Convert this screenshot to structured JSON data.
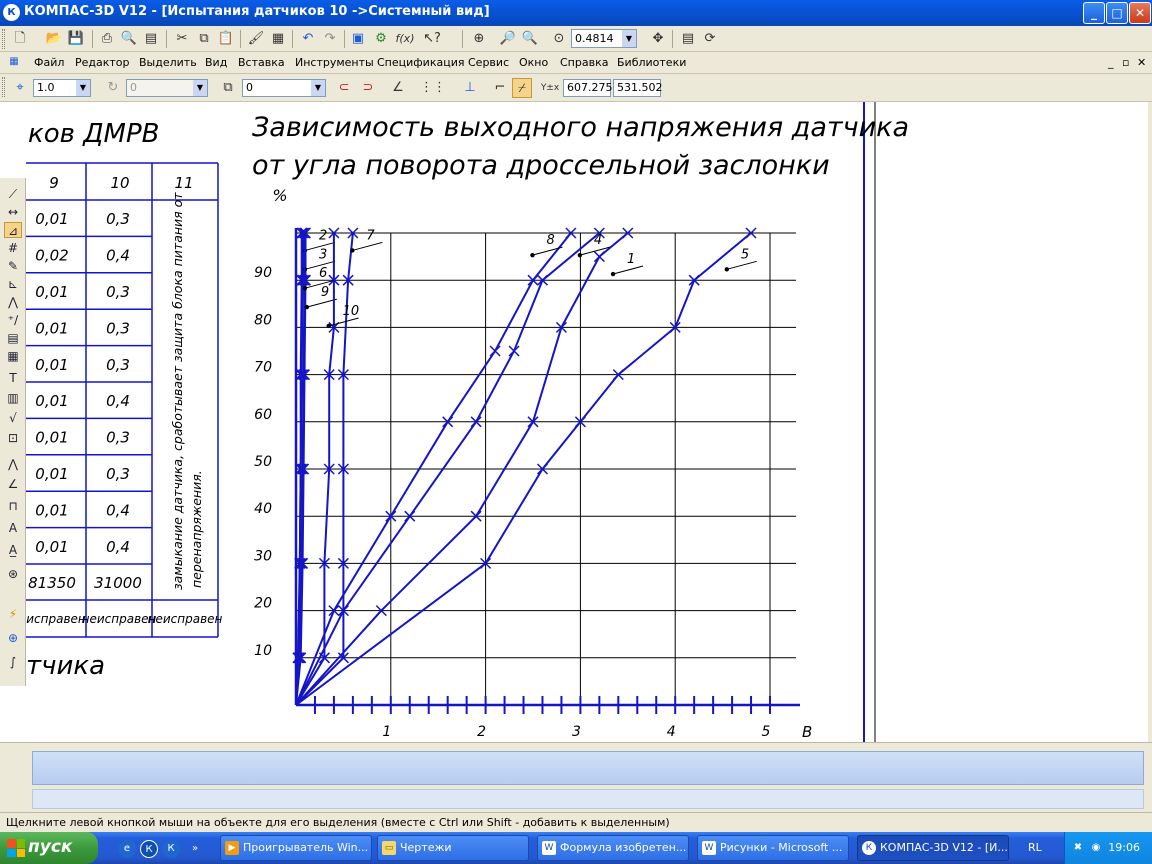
{
  "window": {
    "title": "КОМПАС-3D V12 - [Испытания датчиков 10 ->Системный вид]",
    "app_icon": "kompas-logo-icon",
    "minimize": "_",
    "maximize": "□",
    "close": "✕"
  },
  "toolbar_main": {
    "zoom_value": "0.4814",
    "icons": [
      "new-doc-icon",
      "open-icon",
      "save-icon",
      "print-icon",
      "print-preview-icon",
      "scan-icon",
      "cut-icon",
      "copy-icon",
      "paste-icon",
      "format-brush-icon",
      "properties-icon",
      "undo-icon",
      "redo-icon",
      "manager-icon",
      "variables-icon",
      "fx-icon",
      "help-pointer-icon",
      "zoom-window-icon",
      "zoom-in-icon",
      "zoom-out-icon",
      "zoom-scale-icon",
      "pan-icon",
      "layers-icon",
      "refresh-icon"
    ]
  },
  "menu": {
    "items": [
      "Файл",
      "Редактор",
      "Выделить",
      "Вид",
      "Вставка",
      "Инструменты",
      "Спецификация",
      "Сервис",
      "Окно",
      "Справка",
      "Библиотеки"
    ],
    "mdi_controls": [
      "_",
      "▫",
      "✕"
    ]
  },
  "toolbar_props": {
    "step": "1.0",
    "angle": "0",
    "layer": "0",
    "coord_x": "607.275",
    "coord_y": "531.502"
  },
  "drawing": {
    "table_heading": "ков ДМРВ",
    "bottom_text": "тчика",
    "col_headers": [
      "9",
      "10",
      "11"
    ],
    "col9": [
      "0,01",
      "0,02",
      "0,01",
      "0,01",
      "0,01",
      "0,01",
      "0,01",
      "0,01",
      "0,01",
      "0,01",
      "81350"
    ],
    "col10": [
      "0,3",
      "0,4",
      "0,3",
      "0,3",
      "0,3",
      "0,4",
      "0,3",
      "0,3",
      "0,4",
      "0,4",
      "31000"
    ],
    "col11_rotated_line1": "замыкание датчика, сработывает защита блока питания от",
    "col11_rotated_line2": "перенапряжения.",
    "status_row": [
      "исправен",
      "неисправен",
      "неисправен"
    ]
  },
  "chart_data": {
    "type": "line",
    "title_line1": "Зависимость выходного напряжения датчика",
    "title_line2": "от угла поворота дроссельной заслонки",
    "ylabel": "%",
    "xlabel": "В",
    "x_ticks": [
      "1",
      "2",
      "3",
      "4",
      "5"
    ],
    "y_ticks": [
      "10",
      "20",
      "30",
      "40",
      "50",
      "60",
      "70",
      "80",
      "90"
    ],
    "xlim": [
      0,
      5
    ],
    "ylim": [
      0,
      100
    ],
    "grid": true,
    "series": [
      {
        "name": "1",
        "points": [
          [
            0,
            0
          ],
          [
            0.9,
            20
          ],
          [
            1.9,
            40
          ],
          [
            2.5,
            60
          ],
          [
            2.8,
            80
          ],
          [
            3.2,
            95
          ],
          [
            3.5,
            100
          ]
        ]
      },
      {
        "name": "2",
        "points": [
          [
            0,
            0
          ],
          [
            0.03,
            10
          ],
          [
            0.04,
            30
          ],
          [
            0.05,
            50
          ],
          [
            0.06,
            70
          ],
          [
            0.07,
            90
          ],
          [
            0.07,
            100
          ]
        ]
      },
      {
        "name": "3",
        "points": [
          [
            0,
            0
          ],
          [
            0.05,
            10
          ],
          [
            0.07,
            30
          ],
          [
            0.08,
            50
          ],
          [
            0.09,
            70
          ],
          [
            0.1,
            90
          ],
          [
            0.1,
            100
          ]
        ]
      },
      {
        "name": "4",
        "points": [
          [
            0,
            0
          ],
          [
            0.5,
            20
          ],
          [
            1.2,
            40
          ],
          [
            1.9,
            60
          ],
          [
            2.3,
            75
          ],
          [
            2.6,
            90
          ],
          [
            3.2,
            100
          ]
        ]
      },
      {
        "name": "5",
        "points": [
          [
            0,
            0
          ],
          [
            2.0,
            30
          ],
          [
            2.6,
            50
          ],
          [
            3.0,
            60
          ],
          [
            3.4,
            70
          ],
          [
            4.0,
            80
          ],
          [
            4.2,
            90
          ],
          [
            4.8,
            100
          ]
        ]
      },
      {
        "name": "6",
        "points": [
          [
            0,
            0
          ],
          [
            0.04,
            10
          ],
          [
            0.06,
            30
          ],
          [
            0.07,
            50
          ],
          [
            0.08,
            70
          ],
          [
            0.09,
            90
          ],
          [
            0.09,
            100
          ]
        ]
      },
      {
        "name": "7",
        "points": [
          [
            0,
            0
          ],
          [
            0.5,
            10
          ],
          [
            0.5,
            30
          ],
          [
            0.5,
            50
          ],
          [
            0.5,
            70
          ],
          [
            0.55,
            90
          ],
          [
            0.6,
            100
          ]
        ]
      },
      {
        "name": "8",
        "points": [
          [
            0,
            0
          ],
          [
            0.4,
            20
          ],
          [
            1.0,
            40
          ],
          [
            1.6,
            60
          ],
          [
            2.1,
            75
          ],
          [
            2.5,
            90
          ],
          [
            2.9,
            100
          ]
        ]
      },
      {
        "name": "9",
        "points": [
          [
            0,
            0
          ],
          [
            0.02,
            10
          ],
          [
            0.04,
            30
          ],
          [
            0.05,
            50
          ],
          [
            0.05,
            70
          ],
          [
            0.06,
            90
          ],
          [
            0.06,
            100
          ]
        ]
      },
      {
        "name": "10",
        "points": [
          [
            0,
            0
          ],
          [
            0.3,
            10
          ],
          [
            0.3,
            30
          ],
          [
            0.35,
            50
          ],
          [
            0.35,
            70
          ],
          [
            0.4,
            80
          ],
          [
            0.4,
            90
          ],
          [
            0.4,
            100
          ]
        ]
      }
    ]
  },
  "left_toolbar": {
    "icons": [
      "geometry-icon",
      "dimensions-icon",
      "designations-icon",
      "edit-icon",
      "parametrization-icon",
      "measure-icon",
      "select-icon",
      "spec-icon",
      "reports-icon",
      "text-icon",
      "table-icon",
      "roughness-icon",
      "base-icon",
      "line-leader-icon",
      "position-leader-icon",
      "marking-icon",
      "cut-line-icon",
      "view-arrow-icon",
      "center-icon",
      "axis-icon",
      "wave-icon"
    ]
  },
  "statusbar": {
    "text": "Щелкните левой кнопкой мыши на объекте для его выделения (вместе с Ctrl или Shift - добавить к выделенным)"
  },
  "taskbar": {
    "start_label": "пуск",
    "tasks": [
      {
        "label": "Проигрыватель Win...",
        "icon": "media-player-icon"
      },
      {
        "label": "Чертежи",
        "icon": "folder-icon"
      },
      {
        "label": "Формула изобретен...",
        "icon": "word-doc-icon"
      },
      {
        "label": "Рисунки - Microsoft ...",
        "icon": "word-doc-icon"
      },
      {
        "label": "КОМПАС-3D V12 - [И...",
        "icon": "kompas-logo-icon"
      }
    ],
    "lang": "RL",
    "clock": "19:06"
  }
}
